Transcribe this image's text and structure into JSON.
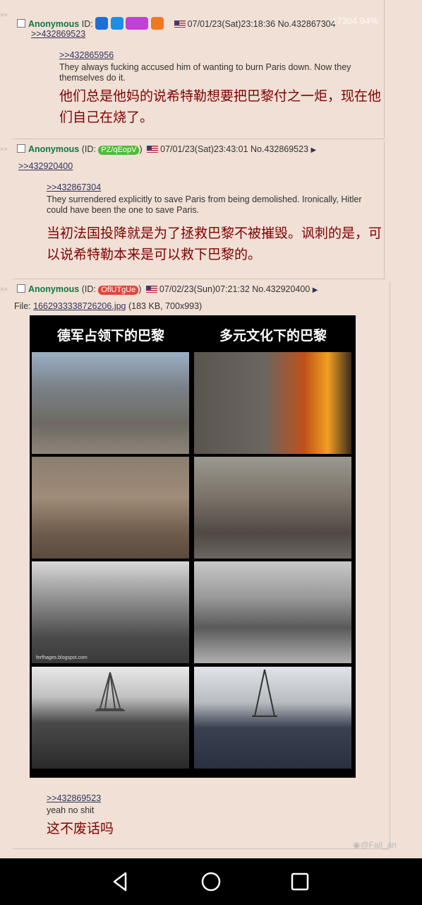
{
  "posts": [
    {
      "name": "Anonymous",
      "id": "",
      "datetime": "07/01/23(Sat)23:18:36",
      "number": "No.432867304",
      "backlink": ">>432869523",
      "quote": ">>432865956",
      "text_en": "They always fucking accused him of wanting to burn Paris down. Now they themselves do it.",
      "text_zh": "他们总是他妈的说希特勒想要把巴黎付之一炬，现在他们自己在烧了。"
    },
    {
      "name": "Anonymous",
      "id": "PZ/qEopV",
      "datetime": "07/01/23(Sat)23:43:01",
      "number": "No.432869523",
      "backlink": ">>432920400",
      "quote": ">>432867304",
      "text_en": "They surrendered explicitly to save Paris from being demolished. Ironically, Hitler could have been the one to save Paris.",
      "text_zh": "当初法国投降就是为了拯救巴黎不被摧毁。讽刺的是，可以说希特勒本来是可以救下巴黎的。"
    },
    {
      "name": "Anonymous",
      "id": "OflUTgUe",
      "datetime": "07/02/23(Sun)07:21:32",
      "number": "No.432920400",
      "file_label": "File:",
      "file_name": "1662933338726206.jpg",
      "file_info": "(183 KB, 700x993)",
      "quote": ">>432869523",
      "text_en": "yeah no shit",
      "text_zh": "这不废话吗"
    }
  ],
  "collage": {
    "left_title": "德军占领下的巴黎",
    "right_title": "多元文化下的巴黎",
    "watermark": "ferfhages.blogspot.com"
  },
  "id_label": "ID:",
  "weibo_watermark": "@Fall_an",
  "status_overlay": "17304 94%",
  "colors": {
    "post_bg": "#f0e0d6",
    "name": "#117743",
    "text": "#800000",
    "link": "#34345c",
    "id_green": "#4bbf34",
    "id_red": "#e2463b"
  }
}
